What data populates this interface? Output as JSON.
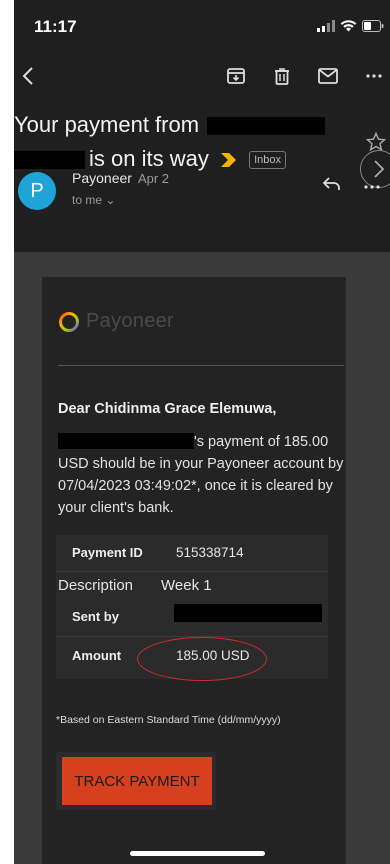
{
  "status_bar": {
    "time": "11:17"
  },
  "subject": {
    "line1_prefix": "Your payment from",
    "line2_suffix": "is on its way",
    "badge": "Inbox"
  },
  "sender": {
    "avatar_letter": "P",
    "name": "Payoneer",
    "date": "Apr 2",
    "to": "to me ⌄"
  },
  "email": {
    "logo_text": "Payoneer",
    "greeting": "Dear Chidinma Grace Elemuwa,",
    "body_after_redaction": "'s payment of 185.00 USD should be in your Payoneer account by 07/04/2023 03:49:02*, once it is cleared by your client's bank.",
    "details": {
      "payment_id_label": "Payment ID",
      "payment_id_value": "515338714",
      "description_label": "Description",
      "description_value": "Week 1",
      "sent_by_label": "Sent by",
      "amount_label": "Amount",
      "amount_value": "185.00 USD"
    },
    "footnote": "*Based on Eastern Standard Time (dd/mm/yyyy)",
    "track_button": "TRACK PAYMENT"
  },
  "icons": {
    "back": "chevron-left-icon",
    "archive": "archive-icon",
    "delete": "trash-icon",
    "mark_unread": "mail-icon",
    "more": "more-icon",
    "star": "star-icon",
    "reply": "reply-icon",
    "next": "chevron-right-icon"
  },
  "colors": {
    "background": "#1f1f1f",
    "avatar": "#1fa4d8",
    "important_marker": "#f5b400",
    "track_button": "#d6401f",
    "annotation_circle": "#d42a2a"
  }
}
